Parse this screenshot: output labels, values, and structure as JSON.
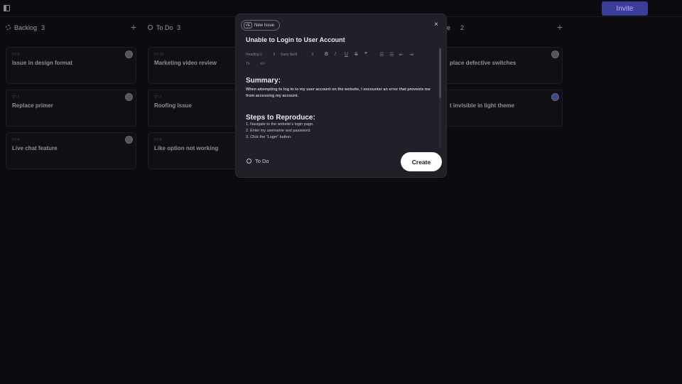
{
  "topbar": {
    "invite_label": "Invite"
  },
  "columns": [
    {
      "title": "Backlog",
      "count": "3",
      "add": "+",
      "cards": [
        {
          "id": "VT-3",
          "title": "Issue in design format"
        },
        {
          "id": "VT-5",
          "title": "Replace primer"
        },
        {
          "id": "VT-4",
          "title": "Live chat feature"
        }
      ]
    },
    {
      "title": "To Do",
      "count": "3",
      "add": "+",
      "cards": [
        {
          "id": "VT-10",
          "title": "Marketing video review"
        },
        {
          "id": "VT-7",
          "title": "Roofing issue"
        },
        {
          "id": "VT-6",
          "title": "Like option not working"
        }
      ]
    },
    {
      "title": "ne",
      "count": "2",
      "add": "+",
      "cards": [
        {
          "title": "place defective switches"
        },
        {
          "title": "t invisible in light theme"
        }
      ]
    }
  ],
  "modal": {
    "pill_key": "VE",
    "pill_label": "New Issue",
    "close": "×",
    "title": "Unable to Login to User Account",
    "toolbar": {
      "heading": "Heading 2",
      "heading_arrow": "⇕",
      "font": "Sans Serif",
      "font_arrow": "⇕",
      "bold": "B",
      "italic": "I",
      "underline": "U",
      "strike": "S",
      "quote": "❞",
      "ordered_list": "☰",
      "bullet_list": "☰",
      "outdent": "⇤",
      "indent": "⇥",
      "clear_format": "Tx",
      "code": "</>"
    },
    "body": {
      "summary_heading": "Summary:",
      "summary_text": "When attempting to log in to my user account on the website, I encounter an error that prevents me from accessing my account.",
      "steps_heading": "Steps to Reproduce:",
      "steps": [
        "1. Navigate to the website's login page.",
        "2. Enter my username and password.",
        "3. Click the \"Login\" button."
      ]
    },
    "status": "To Do",
    "create_label": "Create"
  }
}
